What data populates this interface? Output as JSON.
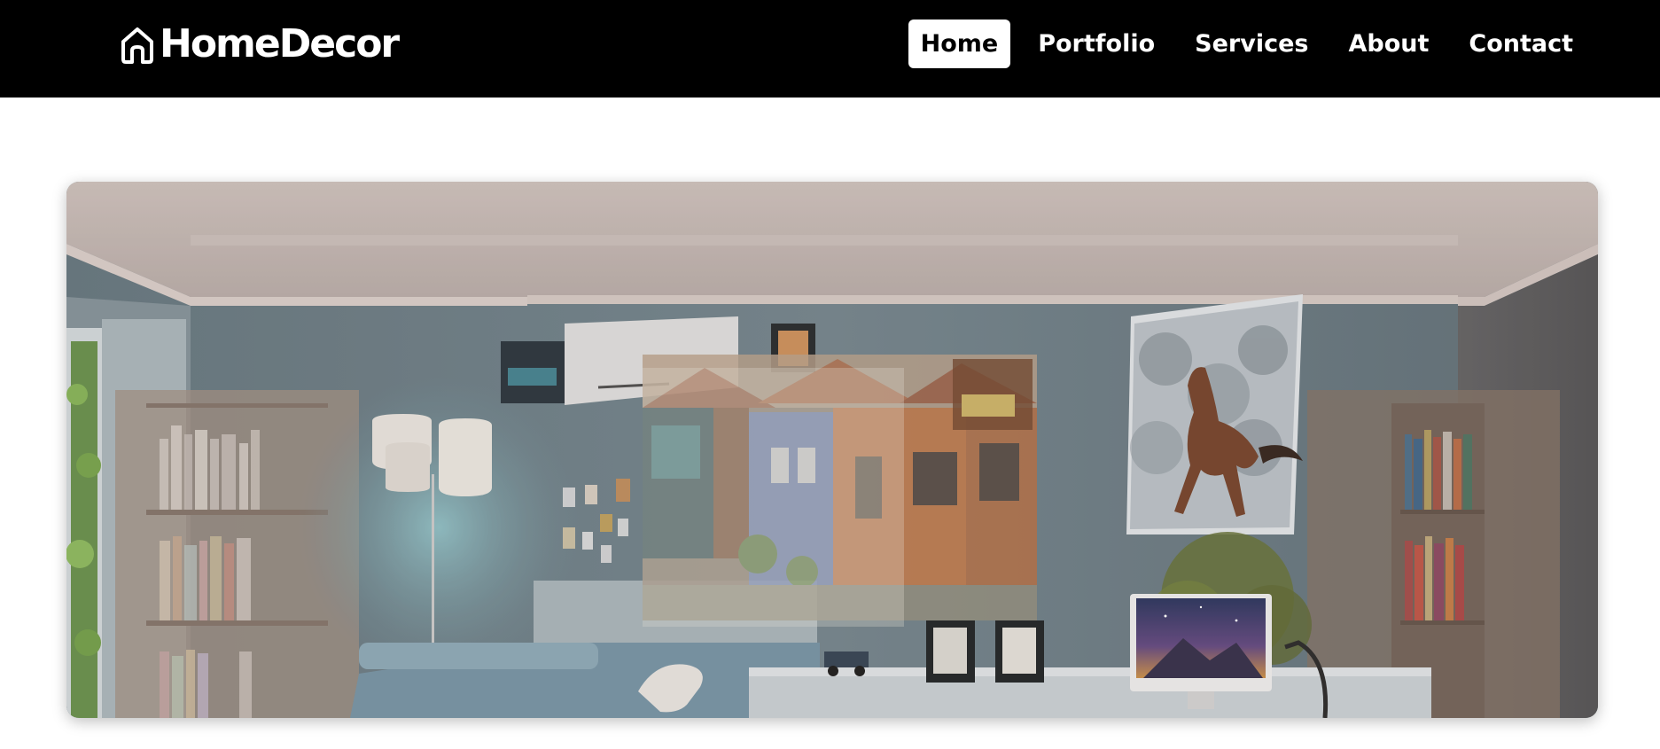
{
  "brand": {
    "name": "HomeDecor",
    "icon": "house-icon"
  },
  "nav": {
    "items": [
      {
        "label": "Home",
        "active": true
      },
      {
        "label": "Portfolio",
        "active": false
      },
      {
        "label": "Services",
        "active": false
      },
      {
        "label": "About",
        "active": false
      },
      {
        "label": "Contact",
        "active": false
      }
    ]
  },
  "hero": {
    "image": "room-interior-image"
  },
  "colors": {
    "navbar_bg": "#000000",
    "nav_text": "#ffffff",
    "active_bg": "#ffffff",
    "active_text": "#000000",
    "page_bg": "#ffffff"
  }
}
